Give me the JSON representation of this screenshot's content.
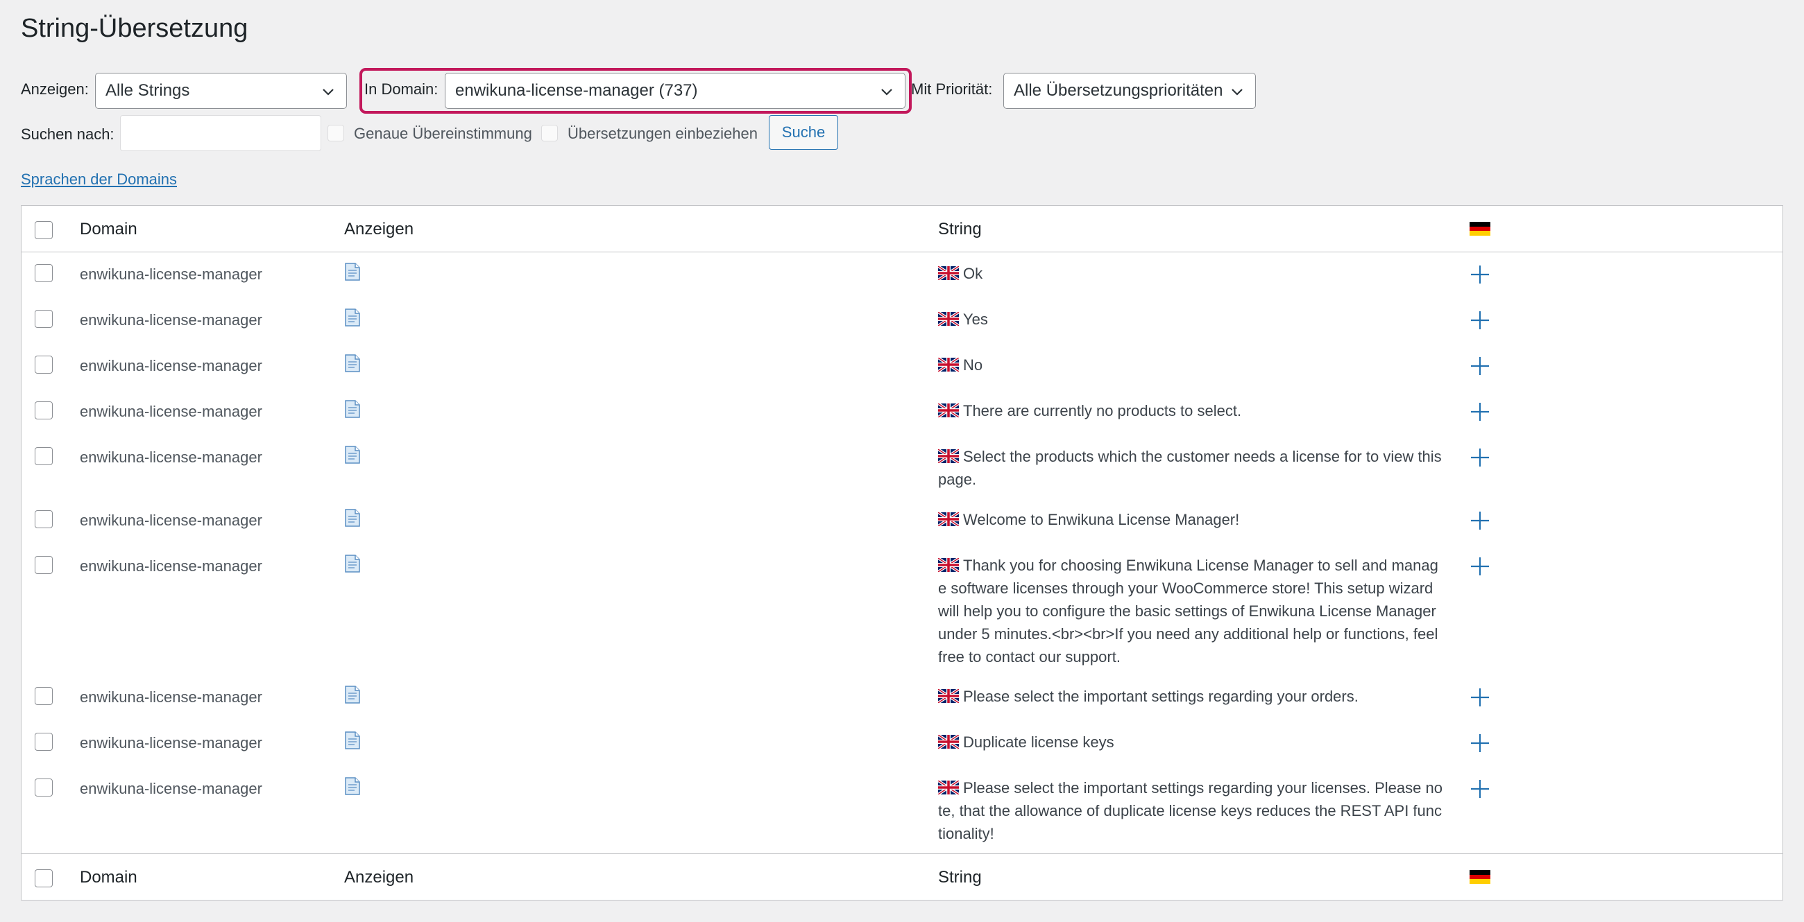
{
  "page_title": "String-Übersetzung",
  "filters": {
    "show_label": "Anzeigen:",
    "show_value": "Alle Strings",
    "domain_label": "In Domain:",
    "domain_value": "enwikuna-license-manager (737)",
    "priority_label": "Mit Priorität:",
    "priority_value": "Alle Übersetzungsprioritäten",
    "search_label": "Suchen nach:",
    "search_value": "",
    "exact_match_label": "Genaue Übereinstimmung",
    "include_translations_label": "Übersetzungen einbeziehen",
    "search_button": "Suche"
  },
  "domain_languages_link": "Sprachen der Domains",
  "table": {
    "headers": {
      "domain": "Domain",
      "view": "Anzeigen",
      "string": "String",
      "language_flag": "de-flag-icon"
    },
    "rows": [
      {
        "domain": "enwikuna-license-manager",
        "string": "Ok"
      },
      {
        "domain": "enwikuna-license-manager",
        "string": "Yes"
      },
      {
        "domain": "enwikuna-license-manager",
        "string": "No"
      },
      {
        "domain": "enwikuna-license-manager",
        "string": "There are currently no products to select."
      },
      {
        "domain": "enwikuna-license-manager",
        "string": "Select the products which the customer needs a license for to view this page."
      },
      {
        "domain": "enwikuna-license-manager",
        "string": "Welcome to Enwikuna License Manager!"
      },
      {
        "domain": "enwikuna-license-manager",
        "string": "Thank you for choosing Enwikuna License Manager to sell and manage software licenses through your WooCommerce store! This setup wizard will help you to configure the basic settings of Enwikuna License Manager under 5 minutes.<br><br>If you need any additional help or functions, feel free to contact our support."
      },
      {
        "domain": "enwikuna-license-manager",
        "string": "Please select the important settings regarding your orders."
      },
      {
        "domain": "enwikuna-license-manager",
        "string": "Duplicate license keys"
      },
      {
        "domain": "enwikuna-license-manager",
        "string": "Please select the important settings regarding your licenses. Please note, that the allowance of duplicate license keys reduces the REST API functionality!"
      }
    ]
  },
  "colors": {
    "link": "#2271b1",
    "highlight": "#c2185b",
    "background": "#f0f0f1"
  }
}
